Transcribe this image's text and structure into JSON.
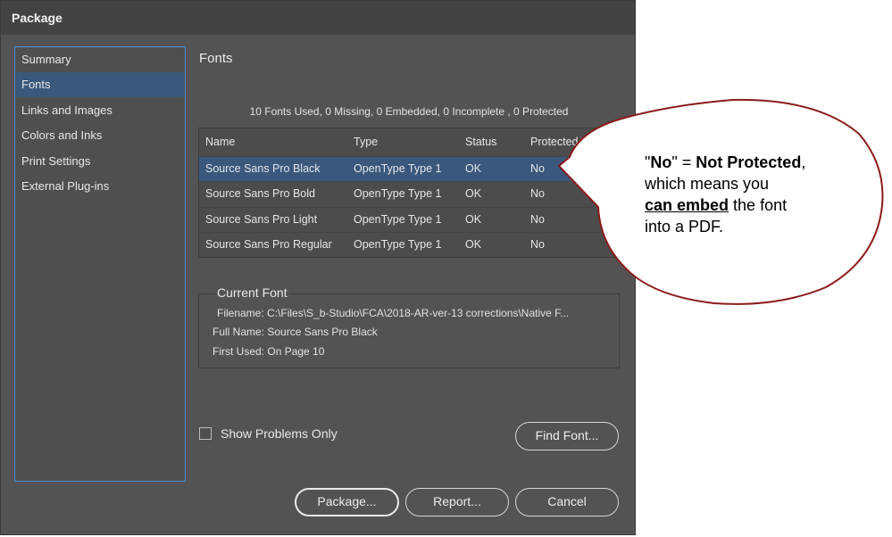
{
  "window": {
    "title": "Package"
  },
  "sidebar": {
    "items": [
      {
        "label": "Summary"
      },
      {
        "label": "Fonts"
      },
      {
        "label": "Links and Images"
      },
      {
        "label": "Colors and Inks"
      },
      {
        "label": "Print Settings"
      },
      {
        "label": "External Plug-ins"
      }
    ],
    "selected": "Fonts"
  },
  "main": {
    "heading": "Fonts",
    "summary": "10 Fonts Used, 0 Missing, 0 Embedded, 0 Incomplete , 0 Protected",
    "table": {
      "columns": [
        "Name",
        "Type",
        "Status",
        "Protected"
      ],
      "rows": [
        {
          "name": "Source Sans Pro Black",
          "type": "OpenType Type 1",
          "status": "OK",
          "protected": "No"
        },
        {
          "name": "Source Sans Pro Bold",
          "type": "OpenType Type 1",
          "status": "OK",
          "protected": "No"
        },
        {
          "name": "Source Sans Pro Light",
          "type": "OpenType Type 1",
          "status": "OK",
          "protected": "No"
        },
        {
          "name": "Source Sans Pro Regular",
          "type": "OpenType Type 1",
          "status": "OK",
          "protected": "No"
        }
      ],
      "selected_row": 0
    },
    "current_font": {
      "title": "Current Font",
      "filename_label": "Filename:",
      "filename_value": "C:\\Files\\S_b-Studio\\FCA\\2018-AR-ver-13 corrections\\Native F...",
      "fullname_label": "Full Name:",
      "fullname_value": "Source Sans Pro Black",
      "firstused_label": "First Used:",
      "firstused_value": "On Page 10"
    },
    "show_problems_label": "Show Problems Only",
    "show_problems_checked": false,
    "find_font_label": "Find Font..."
  },
  "footer": {
    "package_label": "Package...",
    "report_label": "Report...",
    "cancel_label": "Cancel"
  },
  "callout": {
    "q1": "\"",
    "no": "No",
    "q2": "\" = ",
    "not_protected": "Not Protected",
    "comma": ",",
    "line2": "which means you",
    "can_embed": "can embed",
    "line3_rest": " the font",
    "line4": "into a PDF."
  },
  "colors": {
    "dialog_bg": "#535353",
    "selection": "#39587c",
    "sidebar_border": "#4a90d9",
    "callout_border": "#8b1a1a"
  }
}
